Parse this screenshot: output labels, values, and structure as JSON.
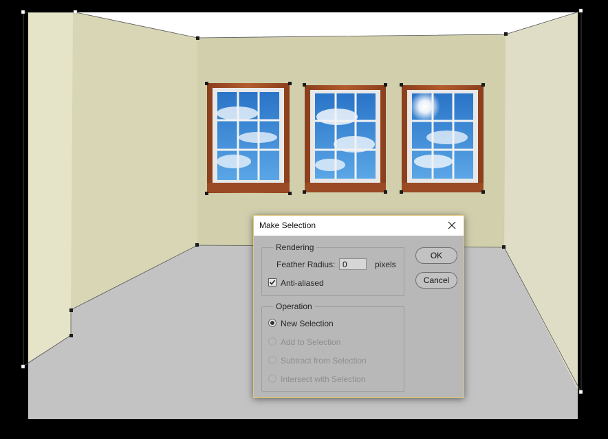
{
  "dialog": {
    "title": "Make Selection",
    "rendering": {
      "legend": "Rendering",
      "feather_label": "Feather Radius:",
      "feather_value": "0",
      "feather_unit": "pixels",
      "anti_aliased_label": "Anti-aliased",
      "anti_aliased_checked": true
    },
    "operation": {
      "legend": "Operation",
      "options": [
        {
          "label": "New Selection",
          "selected": true,
          "enabled": true
        },
        {
          "label": "Add to Selection",
          "selected": false,
          "enabled": false
        },
        {
          "label": "Subtract from Selection",
          "selected": false,
          "enabled": false
        },
        {
          "label": "Intersect with Selection",
          "selected": false,
          "enabled": false
        }
      ]
    },
    "buttons": {
      "ok": "OK",
      "cancel": "Cancel"
    }
  },
  "colors": {
    "canvas_bg": "#000000",
    "ceiling": "#ffffff",
    "back_wall": "#d1cfac",
    "left_wall": "#d8d6b4",
    "right_wall": "#e0ddc6",
    "floor": "#c3c3c3",
    "window_frame": "#a0502a",
    "sky": "#3d8fd6",
    "dialog_bg": "#b8b8b8",
    "dialog_border": "#e0c67a"
  },
  "icons": {
    "close": "close-icon",
    "check": "check-icon"
  }
}
